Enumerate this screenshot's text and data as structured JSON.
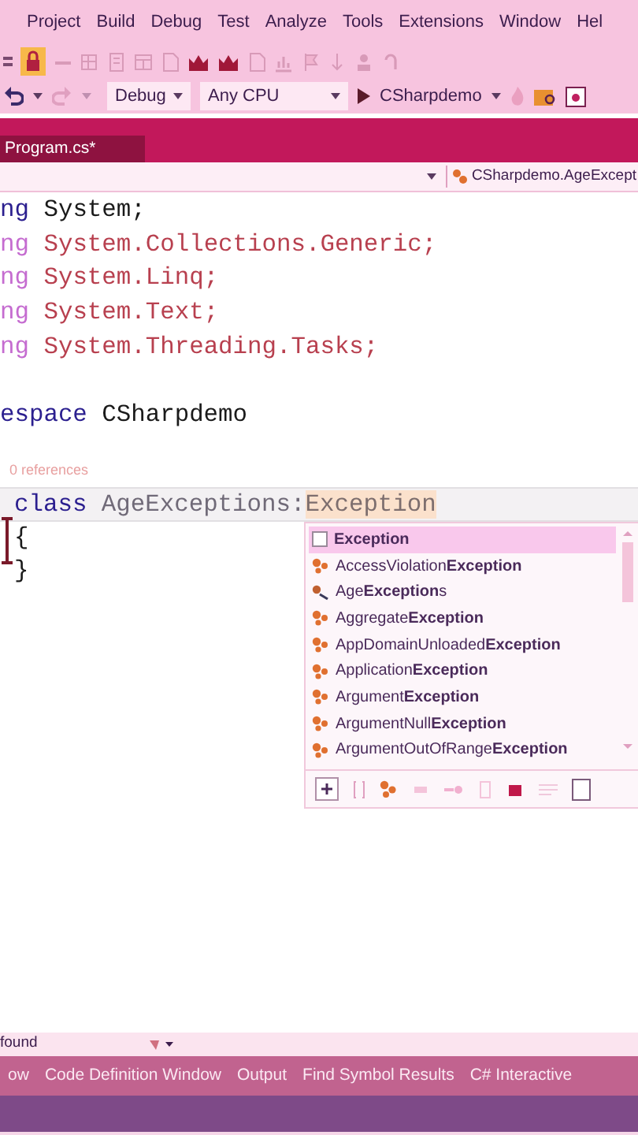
{
  "menu": {
    "items": [
      "Project",
      "Build",
      "Debug",
      "Test",
      "Analyze",
      "Tools",
      "Extensions",
      "Window",
      "Hel"
    ]
  },
  "toolbar": {
    "configuration": "Debug",
    "platform": "Any CPU",
    "start_target": "CSharpdemo"
  },
  "document_tabs": [
    {
      "label": "Program.cs*",
      "selected": true
    }
  ],
  "navigation_bar": {
    "member": "CSharpdemo.AgeExcept"
  },
  "editor": {
    "lines": [
      {
        "kind": "code",
        "indented": false,
        "tokens": [
          {
            "text": "ng",
            "kind": "keyword"
          },
          {
            "text": " System;",
            "kind": "text"
          }
        ]
      },
      {
        "kind": "code",
        "indented": false,
        "tokens": [
          {
            "text": "ng",
            "kind": "keyword_dim"
          },
          {
            "text": " System.Collections.Generic;",
            "kind": "text_dim"
          }
        ]
      },
      {
        "kind": "code",
        "indented": false,
        "tokens": [
          {
            "text": "ng",
            "kind": "keyword_dim"
          },
          {
            "text": " System.Linq;",
            "kind": "text_dim"
          }
        ]
      },
      {
        "kind": "code",
        "indented": false,
        "tokens": [
          {
            "text": "ng",
            "kind": "keyword_dim"
          },
          {
            "text": " System.Text;",
            "kind": "text_dim"
          }
        ]
      },
      {
        "kind": "code",
        "indented": false,
        "tokens": [
          {
            "text": "ng",
            "kind": "keyword_dim"
          },
          {
            "text": " System.Threading.Tasks;",
            "kind": "text_dim"
          }
        ]
      },
      {
        "kind": "blank"
      },
      {
        "kind": "code",
        "indented": false,
        "tokens": [
          {
            "text": "espace",
            "kind": "keyword"
          },
          {
            "text": " CSharpdemo",
            "kind": "text"
          }
        ]
      },
      {
        "kind": "codelens",
        "text": "0 references"
      },
      {
        "kind": "current",
        "indented": true,
        "tokens": [
          {
            "text": "class",
            "kind": "keyword"
          },
          {
            "text": " AgeExceptions",
            "kind": "identifier"
          },
          {
            "text": ":",
            "kind": "identifier"
          },
          {
            "text": "Exception",
            "kind": "typed"
          }
        ]
      },
      {
        "kind": "code",
        "indented": true,
        "tokens": [
          {
            "text": "{",
            "kind": "text"
          }
        ]
      },
      {
        "kind": "code",
        "indented": true,
        "tokens": [
          {
            "text": "}",
            "kind": "text"
          }
        ]
      }
    ],
    "completion": {
      "items": [
        {
          "label": "Exception",
          "kind": "keyword",
          "selected": true
        },
        {
          "label": "AccessViolation**Exception**",
          "kind": "class",
          "selected": false
        },
        {
          "label": "Age**Exception**s",
          "kind": "user_class",
          "selected": false
        },
        {
          "label": "Aggregate**Exception**",
          "kind": "class",
          "selected": false
        },
        {
          "label": "AppDomainUnloaded**Exception**",
          "kind": "class",
          "selected": false
        },
        {
          "label": "Application**Exception**",
          "kind": "class",
          "selected": false
        },
        {
          "label": "Argument**Exception**",
          "kind": "class",
          "selected": false
        },
        {
          "label": "ArgumentNull**Exception**",
          "kind": "class",
          "selected": false
        },
        {
          "label": "ArgumentOutOfRange**Exception**",
          "kind": "class",
          "selected": false
        }
      ]
    }
  },
  "status_bar": {
    "text": "found"
  },
  "tool_tabs": [
    "ow",
    "Code Definition Window",
    "Output",
    "Find Symbol Results",
    "C# Interactive"
  ]
}
